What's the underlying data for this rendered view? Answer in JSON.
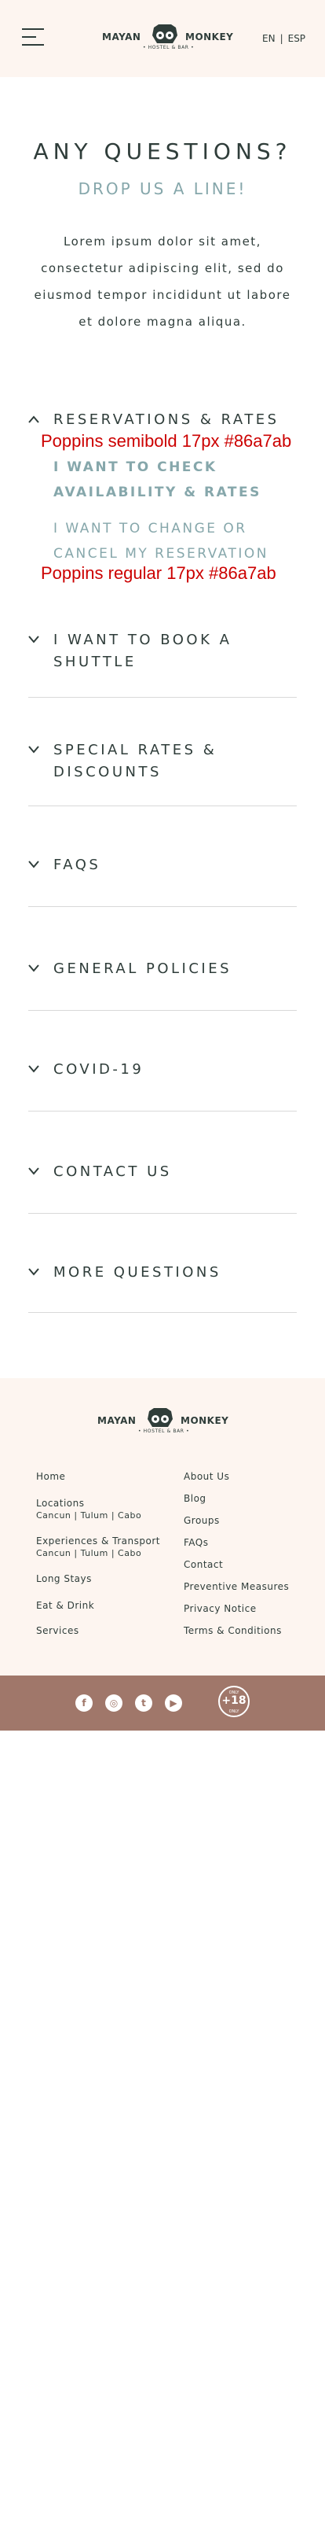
{
  "header": {
    "logo": {
      "left": "MAYAN",
      "right": "MONKEY",
      "sub": "• HOSTEL & BAR •"
    },
    "lang": {
      "en": "EN",
      "sep": "|",
      "esp": "ESP"
    }
  },
  "intro": {
    "title": "ANY QUESTIONS?",
    "subtitle": "DROP US A LINE!",
    "text": "Lorem ipsum dolor sit amet, consectetur adipiscing elit, sed do eiusmod tempor incididunt ut labore et dolore magna aliqua."
  },
  "accordion": {
    "items": [
      {
        "title": "RESERVATIONS & RATES",
        "expanded": true
      },
      {
        "title": "I WANT TO BOOK A SHUTTLE"
      },
      {
        "title": "SPECIAL RATES & DISCOUNTS"
      },
      {
        "title": "FAQS"
      },
      {
        "title": "GENERAL POLICIES"
      },
      {
        "title": "COVID-19"
      },
      {
        "title": "CONTACT US"
      },
      {
        "title": "MORE QUESTIONS"
      }
    ],
    "sub_links": [
      "I WANT TO CHECK AVAILABILITY & RATES",
      "I WANT TO CHANGE OR CANCEL MY RESERVATION"
    ],
    "annotations": [
      "Poppins semibold 17px #86a7ab",
      "Poppins regular 17px #86a7ab"
    ]
  },
  "footer": {
    "logo": {
      "left": "MAYAN",
      "right": "MONKEY",
      "sub": "• HOSTEL & BAR •"
    },
    "left_links": [
      {
        "label": "Home"
      },
      {
        "label": "Locations",
        "sub": "Cancun | Tulum | Cabo"
      },
      {
        "label": "Experiences & Transport",
        "sub": "Cancun | Tulum | Cabo"
      },
      {
        "label": "Long Stays"
      },
      {
        "label": "Eat & Drink"
      },
      {
        "label": "Services"
      }
    ],
    "right_links": [
      "About Us",
      "Blog",
      "Groups",
      "FAQs",
      "Contact",
      "Preventive Measures",
      "Privacy Notice",
      "Terms & Conditions"
    ]
  },
  "social": {
    "icons": [
      "facebook-icon",
      "instagram-icon",
      "twitter-icon",
      "youtube-icon"
    ],
    "glyphs": [
      "f",
      "◎",
      "t",
      "▶"
    ],
    "badge": {
      "top": "ONLY",
      "mid": "+18",
      "bottom": "ONLY"
    }
  },
  "colors": {
    "accent": "#86a7ab",
    "text": "#2f3d3a",
    "cream": "#fdf5f0",
    "brown": "#a0776a",
    "annotation": "#cc0000"
  }
}
